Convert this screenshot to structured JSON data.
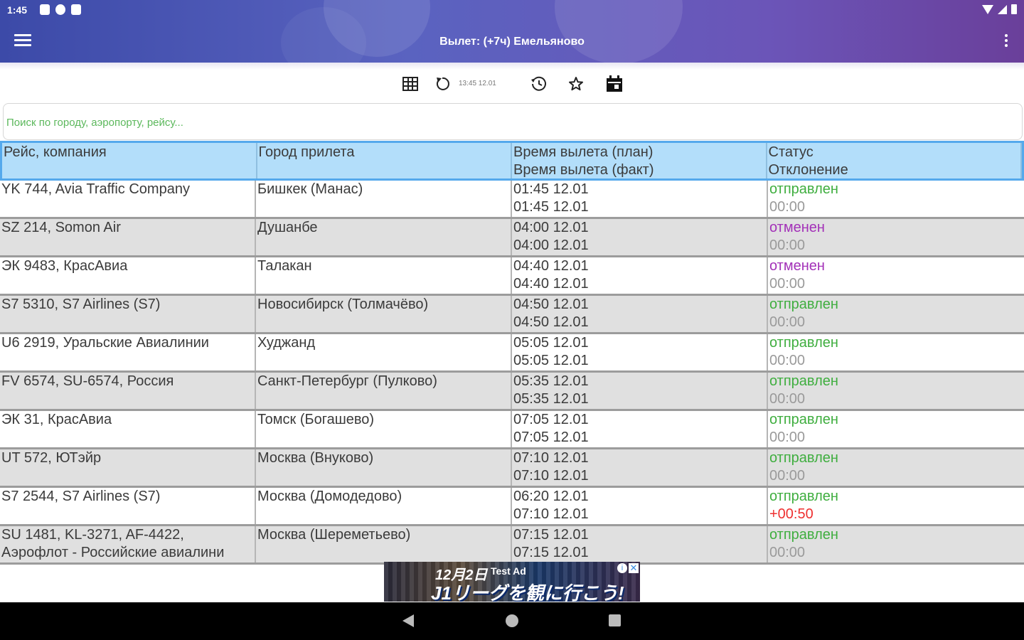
{
  "status_bar": {
    "time": "1:45"
  },
  "app_bar": {
    "title": "Вылет: (+7ч) Емельяново"
  },
  "toolbar": {
    "updated": "13:45 12.01"
  },
  "search": {
    "placeholder": "Поиск по городу, аэропорту, рейсу..."
  },
  "table": {
    "headers": {
      "col1": "Рейс, компания",
      "col2": "Город прилета",
      "col3_a": "Время вылета (план)",
      "col3_b": "Время вылета (факт)",
      "col4_a": "Статус",
      "col4_b": "Отклонение"
    },
    "rows": [
      {
        "flight": "YK 744, Avia Traffic Company",
        "flight2": "",
        "city": "Бишкек (Манас)",
        "plan": "01:45 12.01",
        "fact": "01:45 12.01",
        "status": "отправлен",
        "status_kind": "sent",
        "deviation": "00:00",
        "dev_kind": "zero"
      },
      {
        "flight": "SZ 214, Somon Air",
        "flight2": "",
        "city": "Душанбе",
        "plan": "04:00 12.01",
        "fact": "04:00 12.01",
        "status": "отменен",
        "status_kind": "canc",
        "deviation": "00:00",
        "dev_kind": "zero"
      },
      {
        "flight": "ЭК 9483, КрасАвиа",
        "flight2": "",
        "city": "Талакан",
        "plan": "04:40 12.01",
        "fact": "04:40 12.01",
        "status": "отменен",
        "status_kind": "canc",
        "deviation": "00:00",
        "dev_kind": "zero"
      },
      {
        "flight": "S7 5310, S7 Airlines (S7)",
        "flight2": "",
        "city": "Новосибирск (Толмачёво)",
        "plan": "04:50 12.01",
        "fact": "04:50 12.01",
        "status": "отправлен",
        "status_kind": "sent",
        "deviation": "00:00",
        "dev_kind": "zero"
      },
      {
        "flight": "U6 2919, Уральские Авиалинии",
        "flight2": "",
        "city": "Худжанд",
        "plan": "05:05 12.01",
        "fact": "05:05 12.01",
        "status": "отправлен",
        "status_kind": "sent",
        "deviation": "00:00",
        "dev_kind": "zero"
      },
      {
        "flight": "FV 6574, SU-6574, Россия",
        "flight2": "",
        "city": "Санкт-Петербург (Пулково)",
        "plan": "05:35 12.01",
        "fact": "05:35 12.01",
        "status": "отправлен",
        "status_kind": "sent",
        "deviation": "00:00",
        "dev_kind": "zero"
      },
      {
        "flight": "ЭК 31, КрасАвиа",
        "flight2": "",
        "city": "Томск (Богашево)",
        "plan": "07:05 12.01",
        "fact": "07:05 12.01",
        "status": "отправлен",
        "status_kind": "sent",
        "deviation": "00:00",
        "dev_kind": "zero"
      },
      {
        "flight": "UT 572, ЮТэйр",
        "flight2": "",
        "city": "Москва (Внуково)",
        "plan": "07:10 12.01",
        "fact": "07:10 12.01",
        "status": "отправлен",
        "status_kind": "sent",
        "deviation": "00:00",
        "dev_kind": "zero"
      },
      {
        "flight": "S7 2544, S7 Airlines (S7)",
        "flight2": "",
        "city": "Москва (Домодедово)",
        "plan": "06:20 12.01",
        "fact": "07:10 12.01",
        "status": "отправлен",
        "status_kind": "sent",
        "deviation": "+00:50",
        "dev_kind": "late"
      },
      {
        "flight": "SU 1481, KL-3271, AF-4422,",
        "flight2": "Аэрофлот - Российские авиалини",
        "city": "Москва (Шереметьево)",
        "plan": "07:15 12.01",
        "fact": "07:15 12.01",
        "status": "отправлен",
        "status_kind": "sent",
        "deviation": "00:00",
        "dev_kind": "zero"
      }
    ]
  },
  "ad": {
    "line1": "12月2日",
    "tag": "Test Ad",
    "line2": "J1リーグを観に行こう!"
  },
  "colors": {
    "accent_start": "#3c4aa8",
    "accent_end": "#6a3f9a",
    "status_sent": "#3fae3f",
    "status_canceled": "#a331b8",
    "deviation_late": "#ee3030",
    "header_bg": "#b3defa"
  }
}
